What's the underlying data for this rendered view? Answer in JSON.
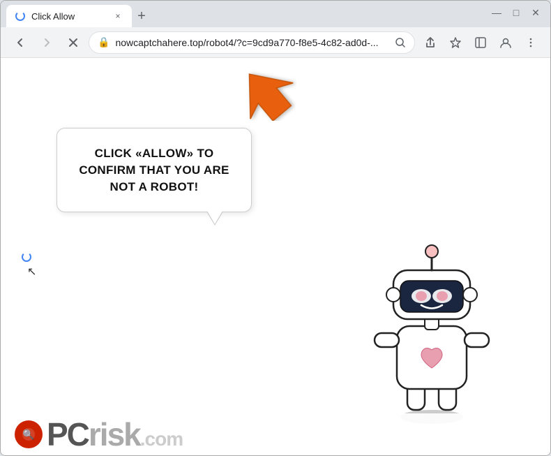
{
  "browser": {
    "tab": {
      "favicon": "spinner",
      "title": "Click Allow",
      "close_label": "×"
    },
    "new_tab_label": "+",
    "window_controls": {
      "minimize": "—",
      "maximize": "□",
      "close": "✕"
    },
    "nav": {
      "back_label": "←",
      "forward_label": "→",
      "reload_label": "✕",
      "url": "nowcaptchahere.top/robot4/?c=9cd9a770-f8e5-4c82-ad0d-...",
      "search_icon": "🔍",
      "share_icon": "⬆",
      "bookmark_icon": "☆",
      "sidebar_icon": "⊡",
      "profile_icon": "👤",
      "menu_icon": "⋮"
    },
    "content": {
      "bubble_text": "CLICK «ALLOW» TO CONFIRM THAT YOU ARE NOT A ROBOT!",
      "logo_text": "PCrisk.com"
    }
  }
}
